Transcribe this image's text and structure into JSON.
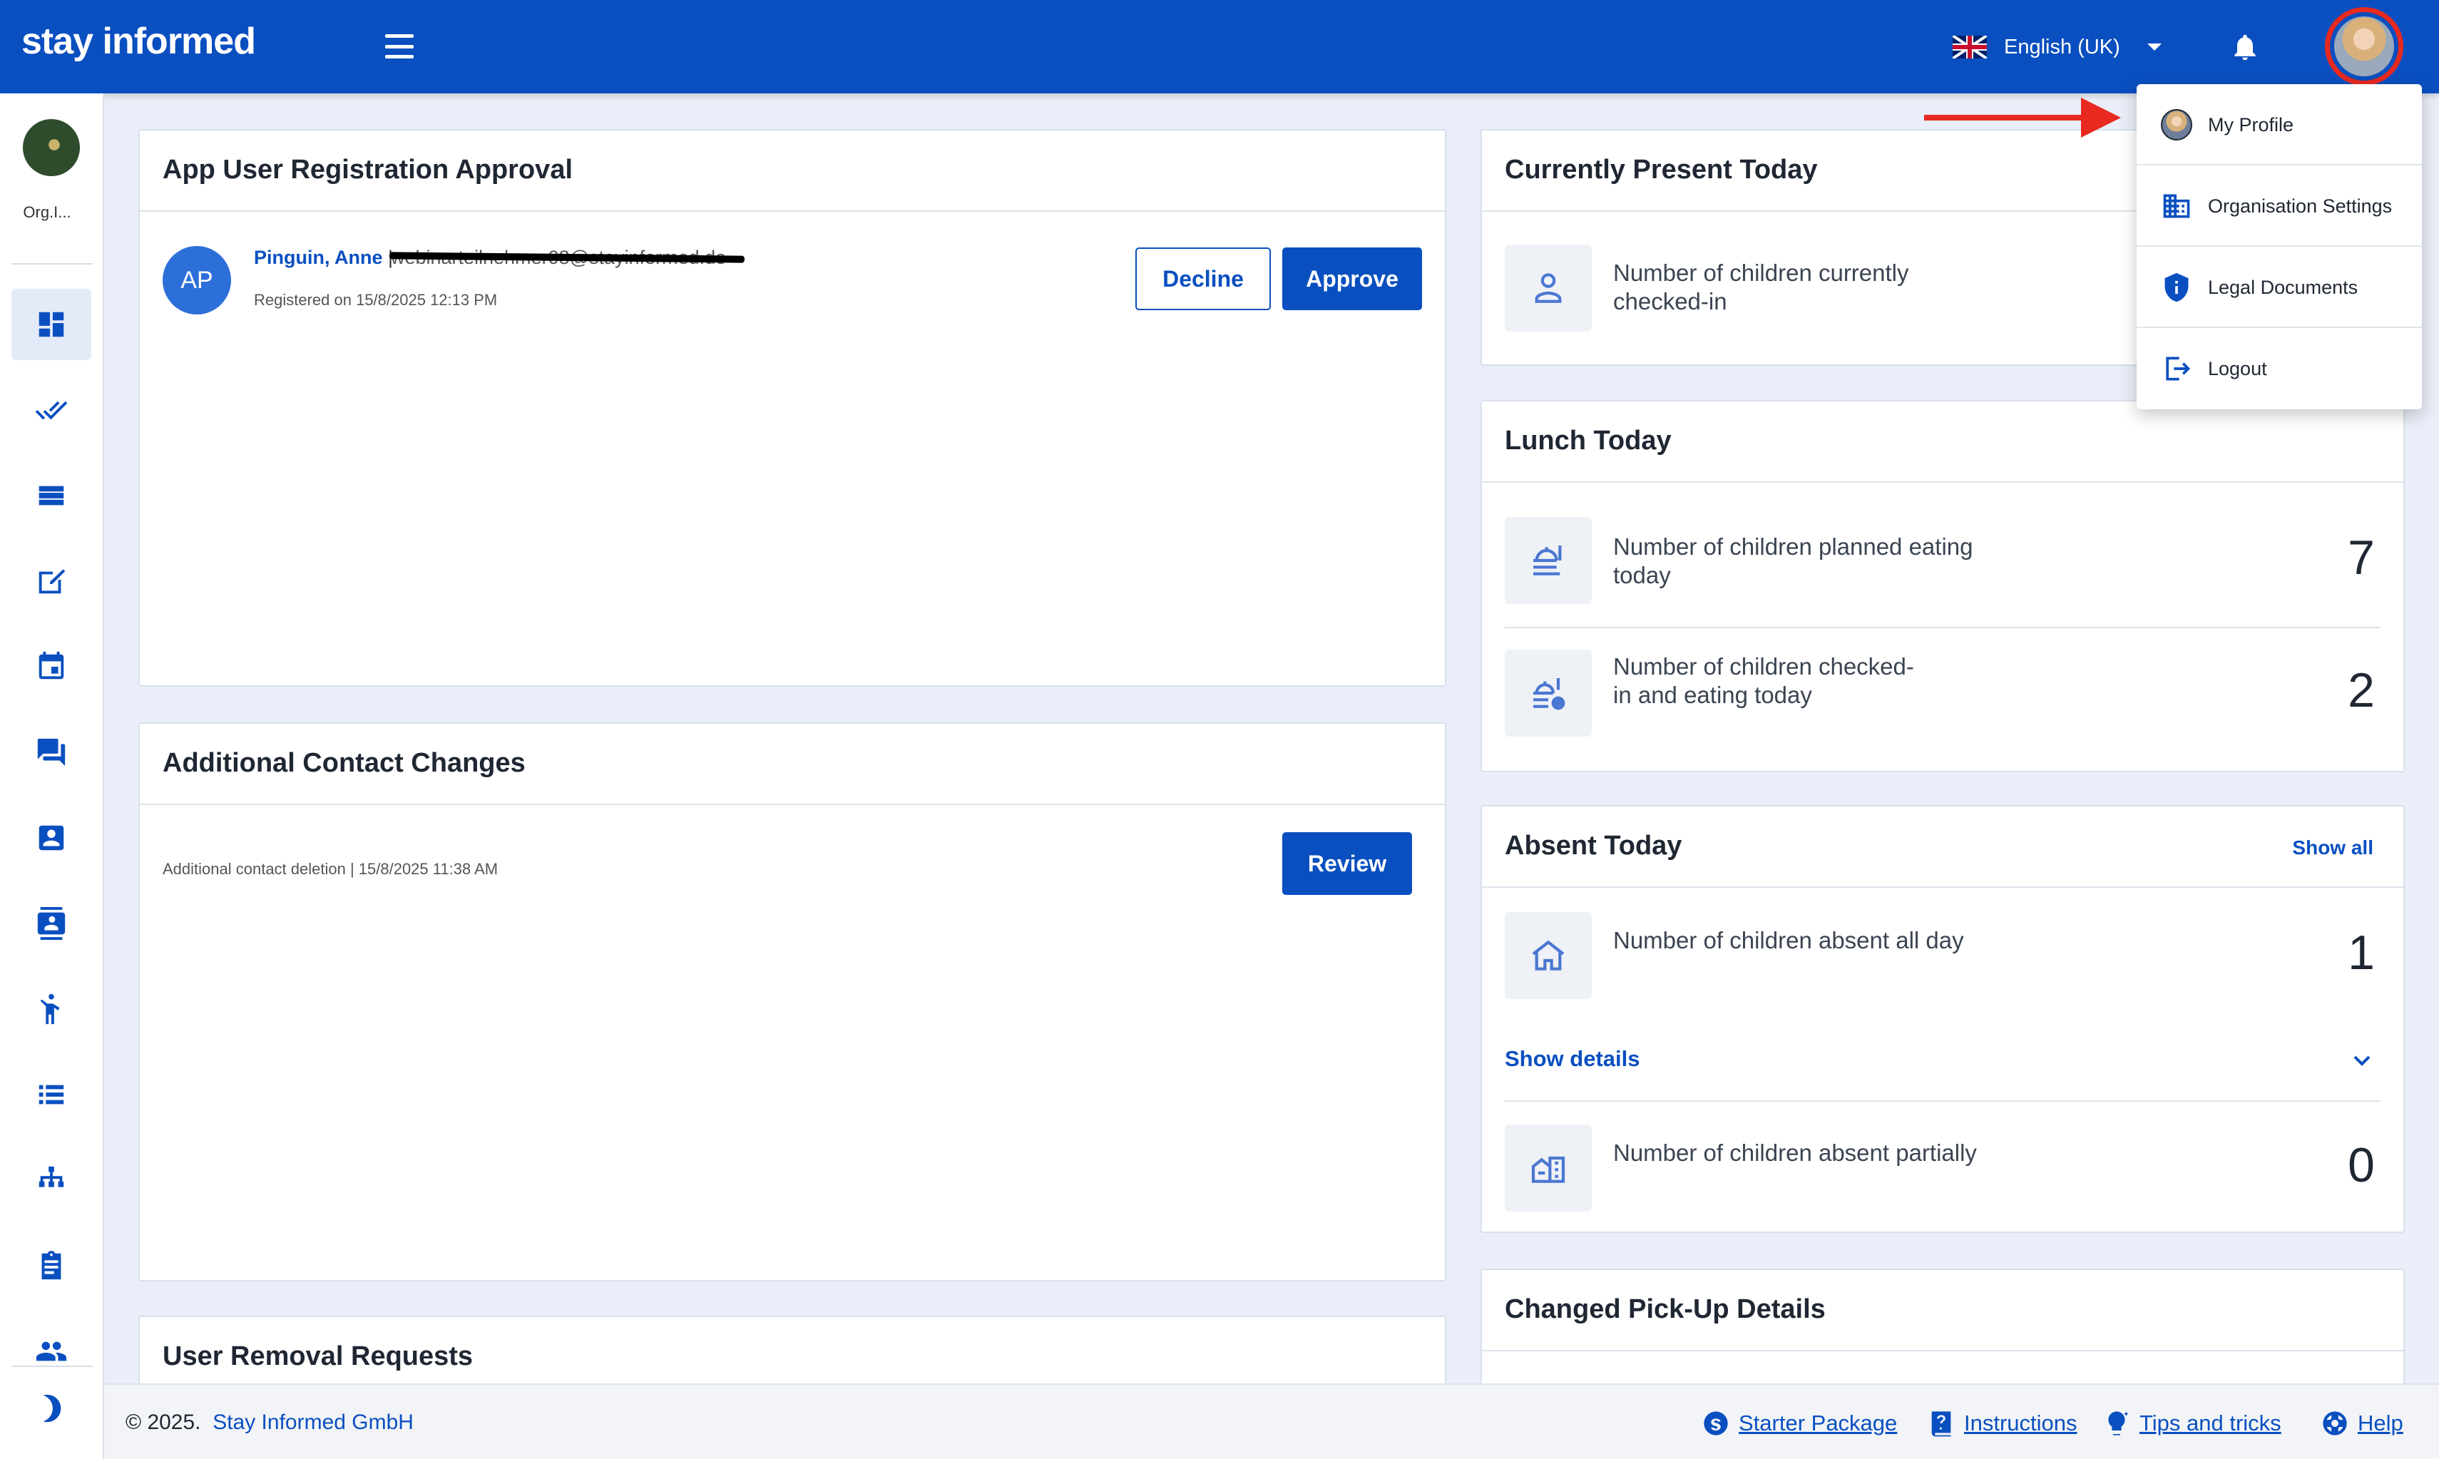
{
  "app": {
    "logo": "stay informed"
  },
  "header": {
    "language": "English (UK)"
  },
  "sidebar": {
    "org_name": "Org.I..."
  },
  "registration": {
    "title": "App User Registration Approval",
    "avatar_initials": "AP",
    "name": "Pinguin, Anne",
    "separator": "|",
    "email": "webinarteilnehmer08@stayinformed.de",
    "registered": "Registered on 15/8/2025 12:13 PM",
    "decline_label": "Decline",
    "approve_label": "Approve"
  },
  "contact_changes": {
    "title": "Additional Contact Changes",
    "entry": "Additional contact deletion | 15/8/2025 11:38 AM",
    "review_label": "Review"
  },
  "user_removal": {
    "title": "User Removal Requests"
  },
  "present": {
    "title": "Currently Present Today",
    "checked_in_text": "Number of children currently checked-in"
  },
  "lunch": {
    "title": "Lunch Today",
    "planned_text": "Number of children planned eating today",
    "planned_value": "7",
    "checked_eating_text": "Number of children checked-in and eating today",
    "checked_eating_value": "2"
  },
  "absent": {
    "title": "Absent Today",
    "show_all": "Show all",
    "all_day_text": "Number of children absent all day",
    "all_day_value": "1",
    "show_details": "Show details",
    "partially_text": "Number of children absent partially",
    "partially_value": "0"
  },
  "pickup": {
    "title": "Changed Pick-Up Details"
  },
  "menu": {
    "my_profile": "My Profile",
    "org_settings": "Organisation Settings",
    "legal": "Legal Documents",
    "logout": "Logout"
  },
  "footer": {
    "copyright": "© 2025.",
    "company": "Stay Informed GmbH",
    "starter": "Starter Package",
    "instructions": "Instructions",
    "tips": "Tips and tricks",
    "help": "Help"
  },
  "colors": {
    "brand": "#0a4fc0",
    "annotation": "#e7291f"
  }
}
